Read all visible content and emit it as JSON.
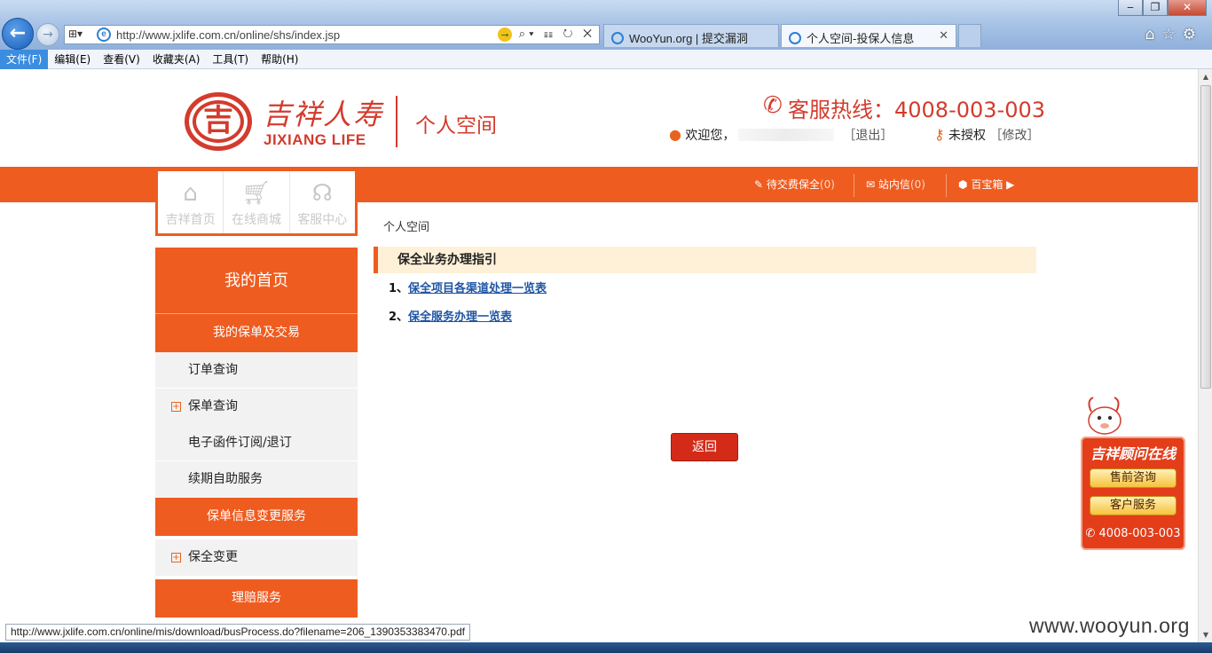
{
  "browser": {
    "url": "http://www.jxlife.com.cn/online/shs/index.jsp",
    "tabs": [
      {
        "label": "WooYun.org | 提交漏洞"
      },
      {
        "label": "个人空间-投保人信息"
      }
    ],
    "menu": [
      "文件(F)",
      "编辑(E)",
      "查看(V)",
      "收藏夹(A)",
      "工具(T)",
      "帮助(H)"
    ],
    "status_url": "http://www.jxlife.com.cn/online/mis/download/busProcess.do?filename=206_1390353383470.pdf",
    "icons": {
      "back": "back-arrow-icon",
      "forward": "forward-arrow-icon",
      "home": "home-icon",
      "favorites": "star-icon",
      "settings": "gear-icon"
    }
  },
  "header": {
    "logo_cn": "吉祥人寿",
    "logo_en": "JIXIANG LIFE",
    "site_title": "个人空间",
    "hotline": "客服热线：4008-003-003",
    "welcome": "欢迎您，",
    "logout": "［退出］",
    "auth_status": "未授权",
    "modify": "［修改］"
  },
  "nav": {
    "tabs": [
      {
        "label": "吉祥首页",
        "icon": "home-icon"
      },
      {
        "label": "在线商城",
        "icon": "cart-icon"
      },
      {
        "label": "客服中心",
        "icon": "headset-icon"
      }
    ],
    "right": [
      {
        "label": "待交费保全",
        "count": "(0)"
      },
      {
        "label": "站内信",
        "count": "(0)"
      },
      {
        "label": "百宝箱"
      }
    ]
  },
  "sidebar": {
    "home": "我的首页",
    "section1": "我的保单及交易",
    "items1": [
      "订单查询",
      "保单查询",
      "电子函件订阅/退订",
      "续期自助服务"
    ],
    "section2": "保单信息变更服务",
    "items2": [
      "保全变更"
    ],
    "section3": "理赔服务"
  },
  "main": {
    "breadcrumb": "个人空间",
    "heading": "保全业务办理指引",
    "links": [
      {
        "num": "1、",
        "text": "保全项目各渠道处理一览表"
      },
      {
        "num": "2、",
        "text": "保全服务办理一览表"
      }
    ],
    "back_button": "返回"
  },
  "advisor": {
    "title": "吉祥顾问在线",
    "buttons": [
      "售前咨询",
      "客户服务"
    ],
    "phone": "4008-003-003"
  },
  "watermark": "www.wooyun.org",
  "colors": {
    "brand_orange": "#ef5c20",
    "brand_red": "#d33b2c",
    "link_blue": "#1f56a4"
  }
}
